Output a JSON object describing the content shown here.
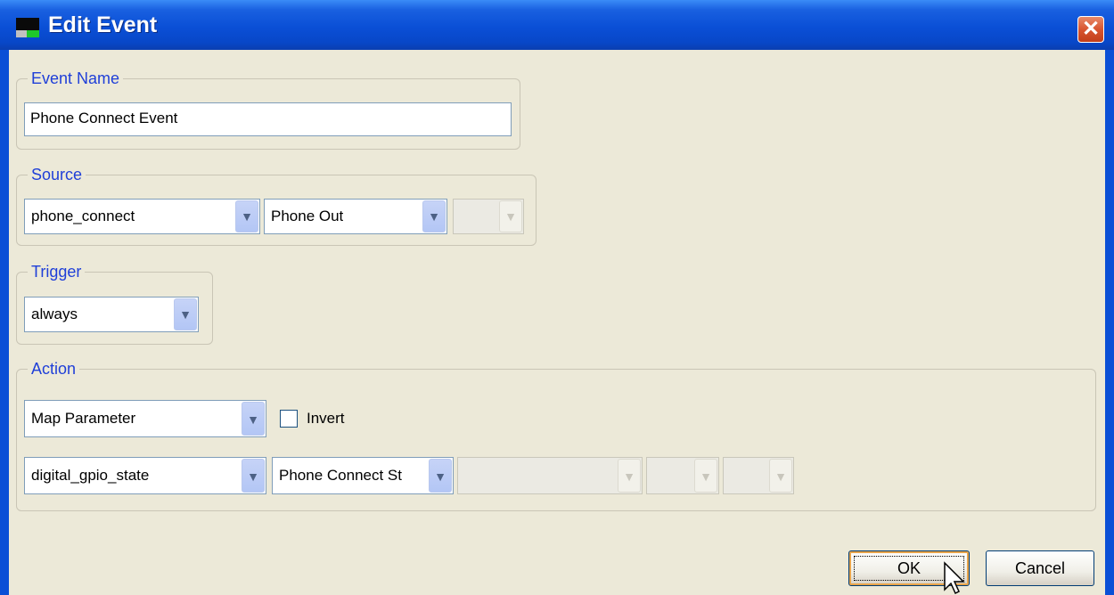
{
  "window": {
    "title": "Edit Event",
    "close_glyph": "✕"
  },
  "event_name": {
    "legend": "Event Name",
    "value": "Phone Connect Event"
  },
  "source": {
    "legend": "Source",
    "combo1": "phone_connect",
    "combo2": "Phone Out",
    "combo3": ""
  },
  "trigger": {
    "legend": "Trigger",
    "combo": "always"
  },
  "action": {
    "legend": "Action",
    "type_combo": "Map Parameter",
    "invert_label": "Invert",
    "invert_checked": false,
    "param_combo": "digital_gpio_state",
    "target_combo": "Phone Connect St",
    "extra_combos": [
      "",
      "",
      ""
    ]
  },
  "buttons": {
    "ok": "OK",
    "cancel": "Cancel"
  },
  "colors": {
    "title_bar": "#0a4fd6",
    "legend_text": "#1f3fd8",
    "dialog_bg": "#ece9d8"
  },
  "icons": {
    "dropdown": "chevron-down-icon",
    "close": "close-icon",
    "cursor": "mouse-pointer-icon"
  }
}
